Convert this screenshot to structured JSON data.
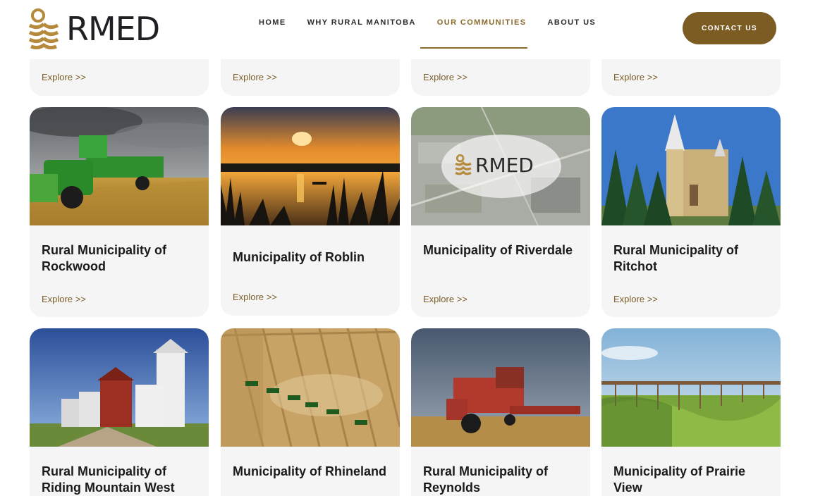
{
  "brand": {
    "name": "RMED"
  },
  "nav": {
    "items": [
      {
        "label": "HOME"
      },
      {
        "label": "WHY RURAL MANITOBA"
      },
      {
        "label": "OUR COMMUNITIES",
        "active": true
      },
      {
        "label": "ABOUT US"
      }
    ],
    "contact_label": "CONTACT US"
  },
  "colors": {
    "accent": "#7c5c22",
    "card_bg": "#f5f5f5",
    "link": "#7a5e2a"
  },
  "explore_label": "Explore >>",
  "row_top": {
    "explore": [
      "Explore >>",
      "Explore >>",
      "Explore >>",
      "Explore >>"
    ]
  },
  "row_middle": [
    {
      "title": "Rural Municipality of Rockwood",
      "image": "combine-harvester-photo",
      "explore": "Explore >>"
    },
    {
      "title": "Municipality of Roblin",
      "image": "lake-sunset-photo",
      "explore": "Explore >>"
    },
    {
      "title": "Municipality of Riverdale",
      "image": "rmed-aerial-placeholder",
      "image_text": "RMED",
      "explore": "Explore >>"
    },
    {
      "title": "Rural Municipality of Ritchot",
      "image": "church-photo",
      "explore": "Explore >>"
    }
  ],
  "row_bottom": [
    {
      "title": "Rural Municipality of Riding Mountain West",
      "image": "grain-elevators-photo"
    },
    {
      "title": "Municipality of Rhineland",
      "image": "aerial-harvest-photo"
    },
    {
      "title": "Rural Municipality of Reynolds",
      "image": "red-combine-photo"
    },
    {
      "title": "Municipality of Prairie View",
      "image": "trestle-bridge-photo"
    }
  ]
}
